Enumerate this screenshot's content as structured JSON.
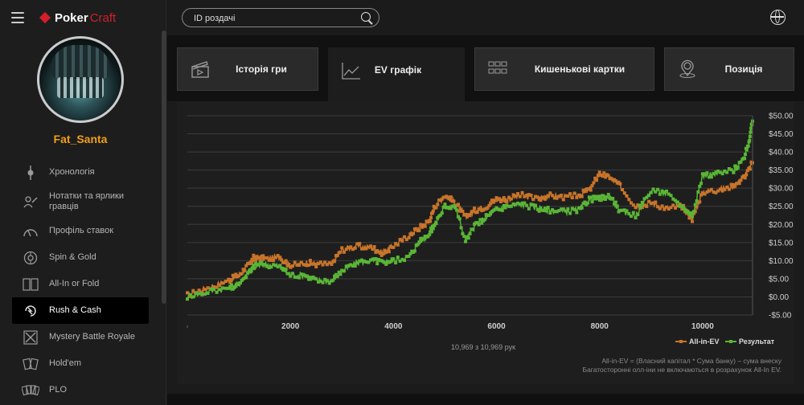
{
  "app": {
    "brand_main": "Poker",
    "brand_accent": "Craft",
    "username": "Fat_Santa"
  },
  "search": {
    "placeholder": "ID роздачі"
  },
  "sidebar": {
    "items": [
      {
        "label": "Хронологія",
        "icon": "timeline-icon"
      },
      {
        "label": "Нотатки та ярлики гравців",
        "icon": "notes-icon"
      },
      {
        "label": "Профіль ставок",
        "icon": "gauge-icon"
      },
      {
        "label": "Spin & Gold",
        "icon": "spin-gold-icon"
      },
      {
        "label": "All-In or Fold",
        "icon": "all-in-fold-icon"
      },
      {
        "label": "Rush & Cash",
        "icon": "rush-cash-icon",
        "active": true
      },
      {
        "label": "Mystery Battle Royale",
        "icon": "mystery-battle-icon"
      },
      {
        "label": "Hold'em",
        "icon": "holdem-cards-icon"
      },
      {
        "label": "PLO",
        "icon": "plo-cards-icon"
      }
    ]
  },
  "tabs": [
    {
      "label": "Історія гри",
      "icon": "clapperboard-icon"
    },
    {
      "label": "EV графік",
      "icon": "line-chart-icon",
      "active": true
    },
    {
      "label": "Кишенькові картки",
      "icon": "grid-icon"
    },
    {
      "label": "Позиція",
      "icon": "position-icon"
    }
  ],
  "chart_note": {
    "count": "10,969 з 10,969 рук",
    "footnote_line1": "All-in-EV = (Власний капітал * Сума банку) – сума внеску",
    "footnote_line2": "Багатосторонні олл-іни не включаються в розрахунок All-In EV."
  },
  "colors": {
    "accent": "#f0a018",
    "brand_red": "#d21f2a",
    "allin_ev": "#c8742a",
    "result": "#5ab536"
  },
  "chart_data": {
    "type": "line",
    "xlim": [
      0,
      10969
    ],
    "ylim": [
      -5,
      50
    ],
    "xticks": [
      "2000",
      "4000",
      "6000",
      "8000",
      "10000"
    ],
    "xtick_values": [
      2000,
      4000,
      6000,
      8000,
      10000
    ],
    "yticks": [
      "-$5.00",
      "$0.00",
      "$5.00",
      "$10.00",
      "$15.00",
      "$20.00",
      "$25.00",
      "$30.00",
      "$35.00",
      "$40.00",
      "$45.00",
      "$50.00"
    ],
    "ytick_values": [
      -5,
      0,
      5,
      10,
      15,
      20,
      25,
      30,
      35,
      40,
      45,
      50
    ],
    "legend_position": "bottom-right",
    "grid": true,
    "series": [
      {
        "name": "All-in-EV",
        "color": "#c8742a",
        "x": [
          0,
          400,
          800,
          1000,
          1200,
          1300,
          1500,
          1800,
          2000,
          2300,
          2500,
          2800,
          3000,
          3300,
          3600,
          3800,
          4000,
          4300,
          4500,
          4700,
          4800,
          5000,
          5200,
          5400,
          5600,
          5800,
          6000,
          6200,
          6500,
          6800,
          7000,
          7300,
          7600,
          7800,
          8000,
          8200,
          8400,
          8700,
          9000,
          9300,
          9600,
          9800,
          10000,
          10300,
          10600,
          10800,
          10969
        ],
        "y": [
          0.5,
          2.5,
          4.5,
          6,
          9,
          11,
          10.5,
          11,
          8.5,
          9.5,
          9,
          9,
          13,
          14,
          13.5,
          12,
          14,
          17,
          19,
          21,
          25,
          28,
          26,
          22,
          24,
          25,
          27,
          27,
          28,
          27,
          28,
          27.5,
          28,
          29.5,
          34,
          33,
          30.5,
          25,
          26,
          24.5,
          25,
          21.5,
          29,
          29.5,
          30.5,
          33,
          37
        ]
      },
      {
        "name": "Результат",
        "color": "#5ab536",
        "x": [
          0,
          400,
          800,
          1000,
          1200,
          1300,
          1500,
          1800,
          2000,
          2300,
          2500,
          2800,
          3000,
          3300,
          3600,
          3800,
          4000,
          4300,
          4500,
          4700,
          4800,
          5000,
          5200,
          5400,
          5600,
          5800,
          6000,
          6200,
          6500,
          6800,
          7000,
          7300,
          7600,
          7800,
          8000,
          8200,
          8400,
          8700,
          9000,
          9300,
          9600,
          9800,
          10000,
          10300,
          10600,
          10800,
          10900,
          10969
        ],
        "y": [
          0,
          1.5,
          2.5,
          3.5,
          7,
          8.5,
          9,
          8.5,
          6,
          6,
          4.5,
          4.5,
          7,
          9.5,
          10,
          9.5,
          10,
          11,
          15,
          17.5,
          20,
          25,
          25,
          15.5,
          20,
          22,
          24,
          25,
          25.5,
          24.5,
          24,
          23.5,
          24,
          27,
          27,
          28,
          23.5,
          22.5,
          29.5,
          28.5,
          25,
          22.5,
          33.5,
          34,
          35,
          38,
          43,
          48.5
        ]
      }
    ]
  }
}
